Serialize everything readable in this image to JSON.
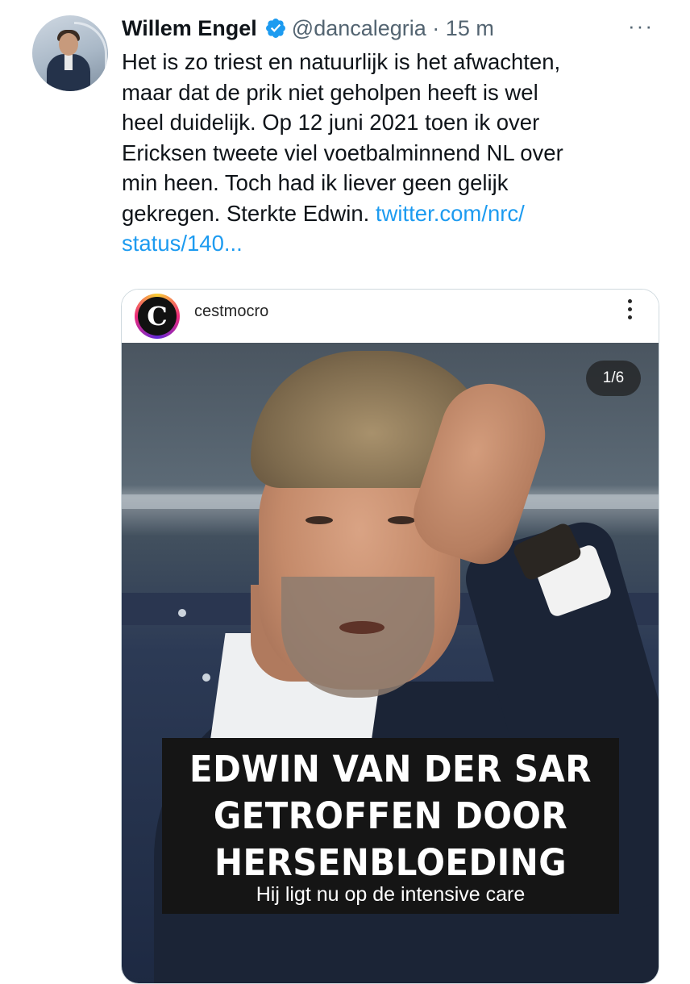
{
  "tweet": {
    "author_name": "Willem Engel",
    "handle_time": "@dancalegria · 15 m",
    "more_glyph": "···",
    "text": "Het is zo triest en natuurlijk is het afwachten,\nmaar dat de prik niet geholpen heeft is wel\nheel duidelijk. Op 12 juni 2021 toen ik over\nEricksen tweete viel voetbalminnend NL over\nmin heen. Toch had ik liever geen gelijk\ngekregen. Sterkte Edwin. ",
    "link_text": "twitter.com/nrc/\nstatus/140...",
    "verified_icon": "verified-badge-icon",
    "link_color": "#1d9bf0",
    "verified_color": "#1d9bf0"
  },
  "embed": {
    "account_initial": "C",
    "account_name": "cestmocro",
    "more_icon": "vertical-dots-icon",
    "slide_counter": "1/6",
    "headline_line1": "EDWIN VAN DER SAR",
    "headline_line2": "GETROFFEN DOOR",
    "headline_line3": "HERSENBLOEDING",
    "subheadline": "Hij ligt nu op de intensive care"
  }
}
